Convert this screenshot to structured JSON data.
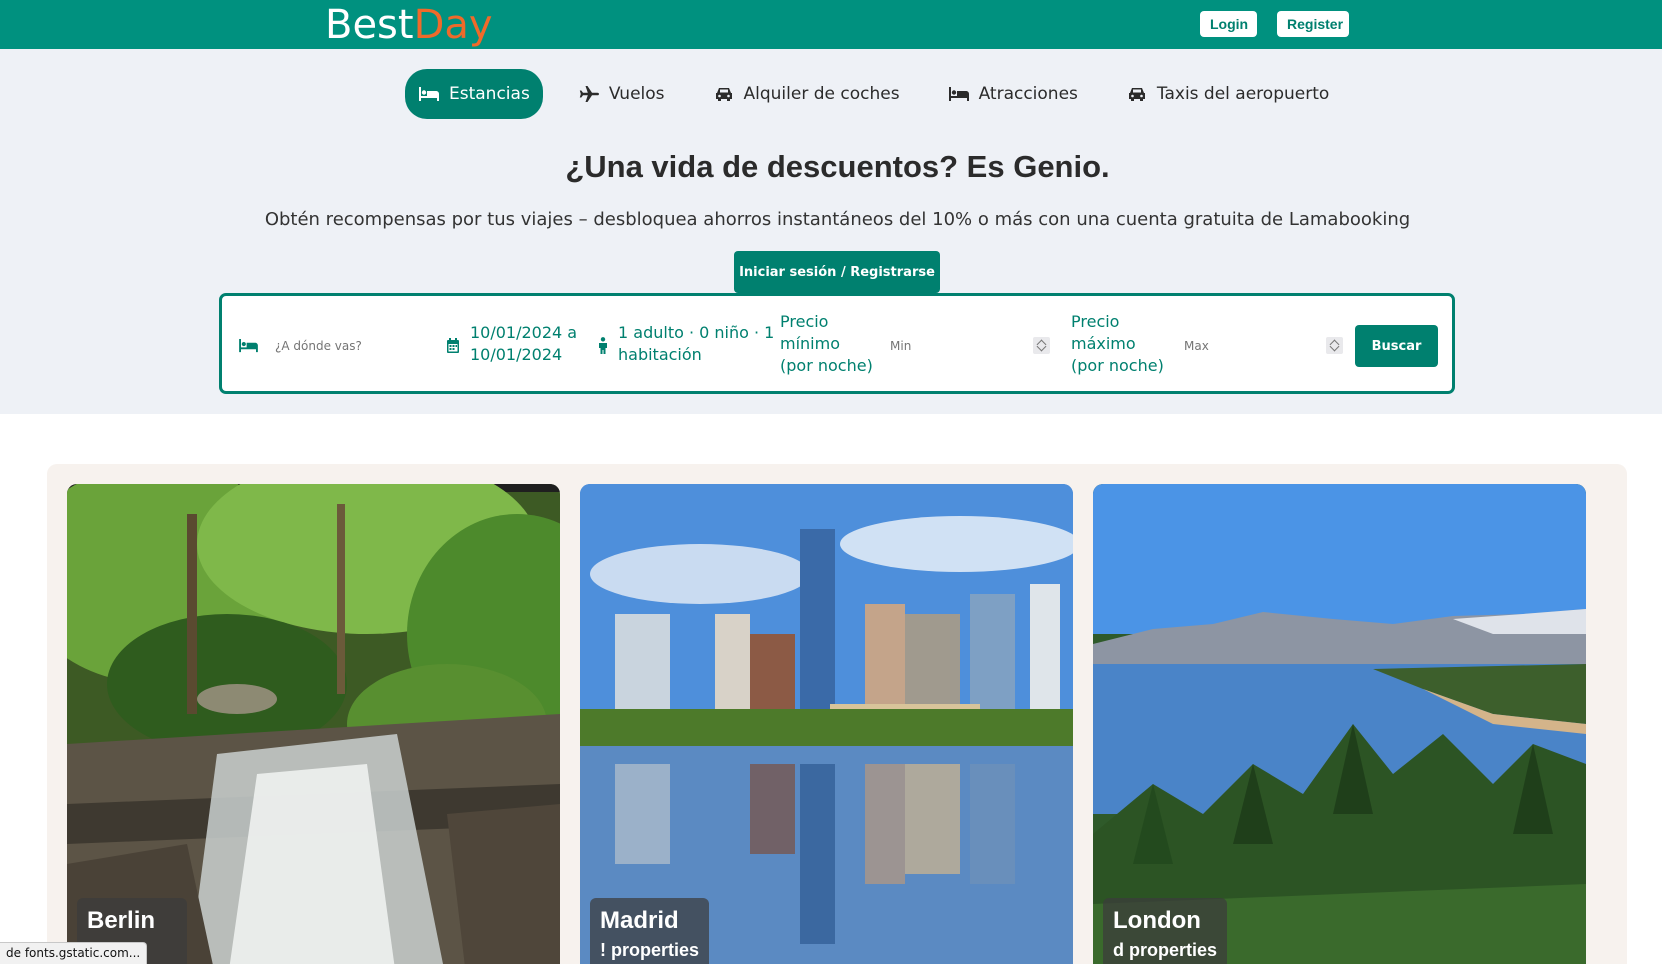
{
  "brand": {
    "part1": "Best",
    "part2": "Day",
    "color_primary": "#00917f",
    "color_accent": "#ef6a2a"
  },
  "auth": {
    "login": "Login",
    "register": "Register"
  },
  "tabs": [
    {
      "label": "Estancias",
      "icon": "bed-icon",
      "active": true
    },
    {
      "label": "Vuelos",
      "icon": "plane-icon",
      "active": false
    },
    {
      "label": "Alquiler de coches",
      "icon": "car-icon",
      "active": false
    },
    {
      "label": "Atracciones",
      "icon": "bed-icon",
      "active": false
    },
    {
      "label": "Taxis del aeropuerto",
      "icon": "car-icon",
      "active": false
    }
  ],
  "hero": {
    "headline": "¿Una vida de descuentos? Es Genio.",
    "subline": "Obtén recompensas por tus viajes – desbloquea ahorros instantáneos del 10% o más con una cuenta gratuita de Lamabooking",
    "cta": "Iniciar sesión / Registrarse"
  },
  "search": {
    "destination_placeholder": "¿A dónde vas?",
    "dates_line1": "10/01/2024 a",
    "dates_line2": "10/01/2024",
    "guests_line1": "1 adulto · 0 niño · 1",
    "guests_line2": "habitación",
    "min_label_1": "Precio",
    "min_label_2": "mínimo",
    "min_label_3": "(por noche)",
    "min_placeholder": "Min",
    "max_label_1": "Precio",
    "max_label_2": "máximo",
    "max_label_3": "(por noche)",
    "max_placeholder": "Max",
    "submit": "Buscar"
  },
  "cards": [
    {
      "city": "Berlin",
      "properties": ""
    },
    {
      "city": "Madrid",
      "properties": "! properties"
    },
    {
      "city": "London",
      "properties": "d properties"
    }
  ],
  "status_bar": "de fonts.gstatic.com..."
}
